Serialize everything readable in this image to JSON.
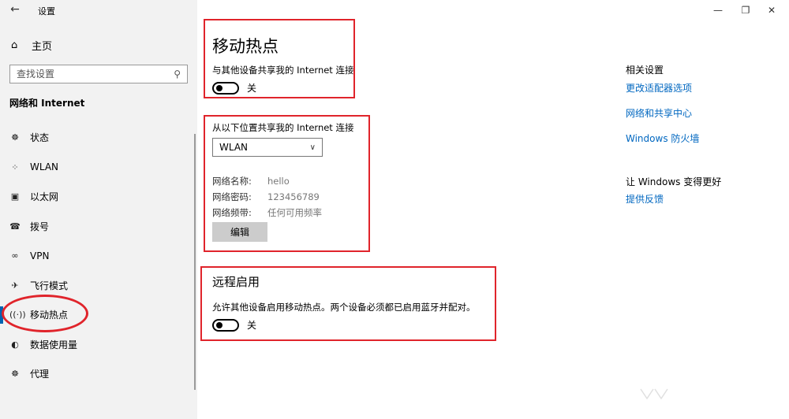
{
  "window": {
    "title": "设置",
    "back_icon": "back-arrow-icon",
    "controls": [
      "minimize-icon",
      "restore-icon",
      "close-icon"
    ]
  },
  "sidebar": {
    "home": {
      "label": "主页",
      "icon": "home-icon"
    },
    "search": {
      "placeholder": "查找设置",
      "value": "",
      "icon": "search-icon"
    },
    "section_title": "网络和 Internet",
    "items": [
      {
        "label": "状态",
        "icon": "globe-icon"
      },
      {
        "label": "WLAN",
        "icon": "wifi-icon"
      },
      {
        "label": "以太网",
        "icon": "ethernet-icon"
      },
      {
        "label": "拨号",
        "icon": "dialup-icon"
      },
      {
        "label": "VPN",
        "icon": "vpn-icon"
      },
      {
        "label": "飞行模式",
        "icon": "airplane-icon"
      },
      {
        "label": "移动热点",
        "icon": "hotspot-icon",
        "active": true
      },
      {
        "label": "数据使用量",
        "icon": "data-usage-icon"
      },
      {
        "label": "代理",
        "icon": "proxy-globe-icon"
      }
    ]
  },
  "main": {
    "title": "移动热点",
    "share_label": "与其他设备共享我的 Internet 连接",
    "share_toggle": {
      "state": "off",
      "label": "关"
    },
    "share_from_label": "从以下位置共享我的 Internet 连接",
    "share_from_select": "WLAN",
    "network": {
      "name_key": "网络名称:",
      "name_val": "hello",
      "password_key": "网络密码:",
      "password_val": "123456789",
      "band_key": "网络频带:",
      "band_val": "任何可用频率"
    },
    "edit_button": "编辑",
    "remote_title": "远程启用",
    "remote_desc": "允许其他设备启用移动热点。两个设备必须都已启用蓝牙并配对。",
    "remote_toggle": {
      "state": "off",
      "label": "关"
    }
  },
  "related": {
    "title": "相关设置",
    "links": [
      "更改适配器选项",
      "网络和共享中心",
      "Windows 防火墙"
    ],
    "improve_title": "让 Windows 变得更好",
    "feedback_link": "提供反馈"
  },
  "colors": {
    "accent": "#0063b1",
    "link": "#0067c0",
    "annotation_red": "#e0242b",
    "sidebar_bg": "#f2f2f2"
  }
}
